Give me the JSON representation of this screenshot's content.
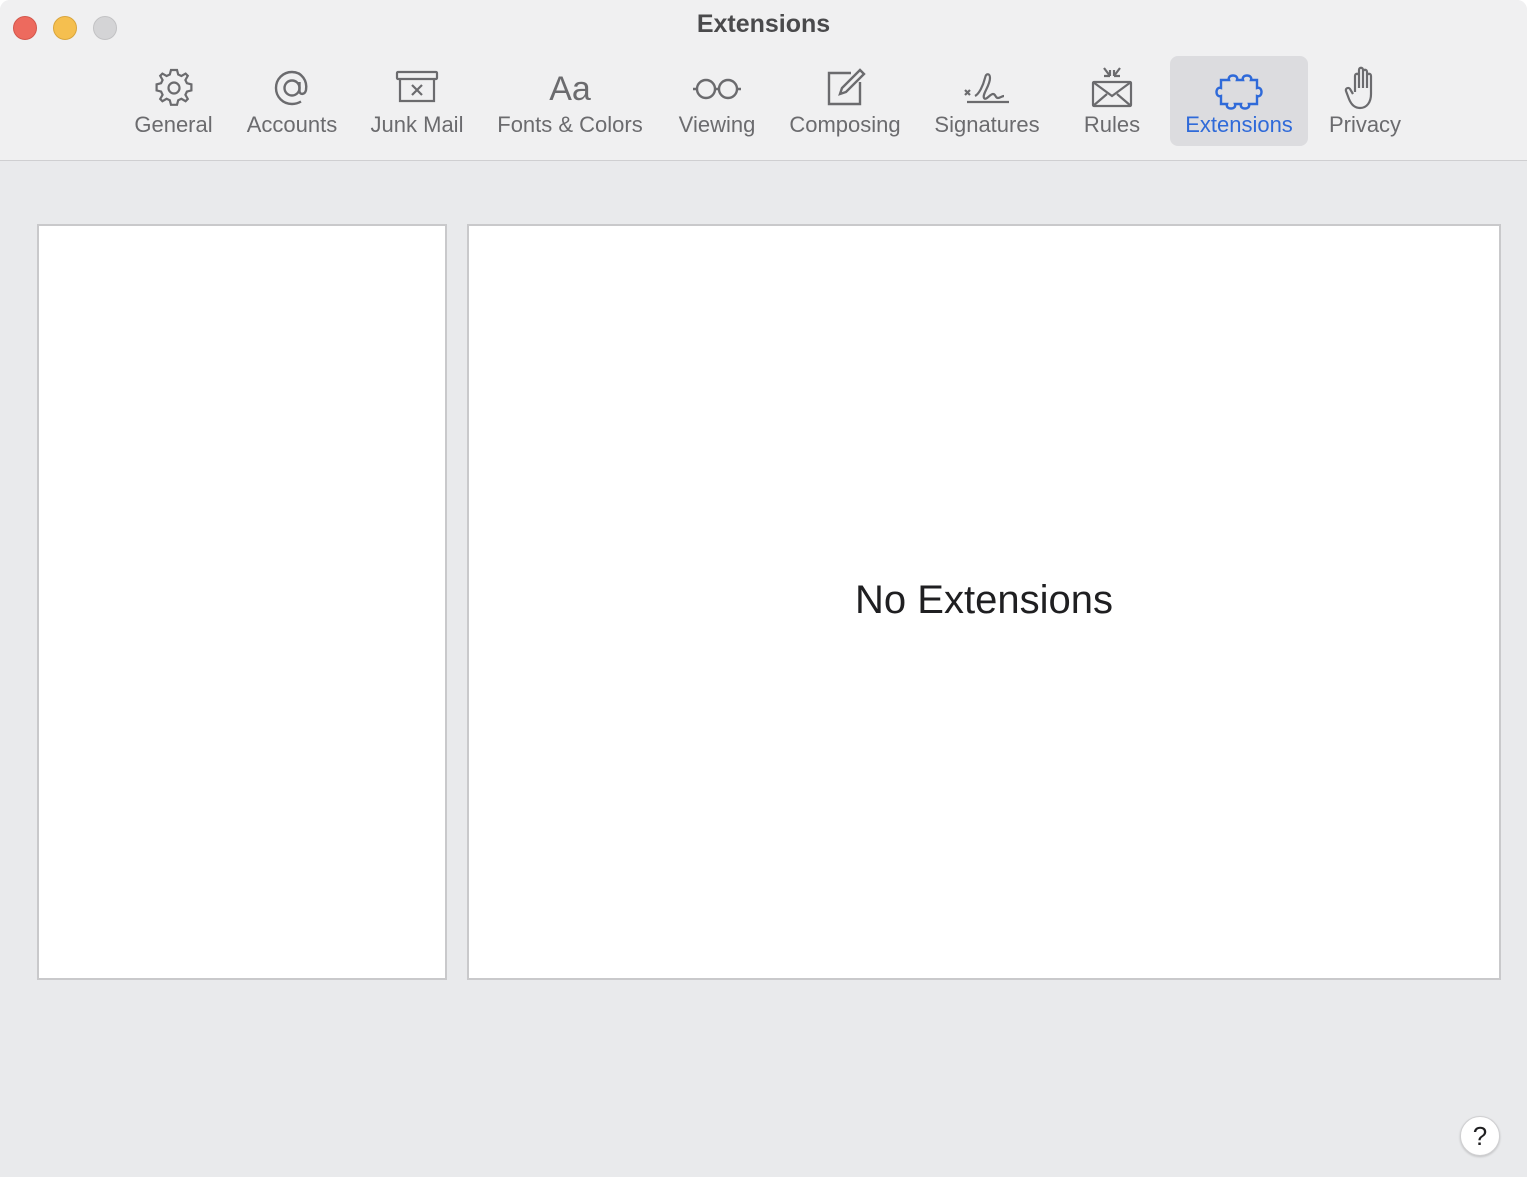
{
  "window": {
    "title": "Extensions"
  },
  "toolbar": {
    "items": [
      {
        "label": "General",
        "icon": "gear-icon"
      },
      {
        "label": "Accounts",
        "icon": "at-sign-icon"
      },
      {
        "label": "Junk Mail",
        "icon": "junk-tray-icon"
      },
      {
        "label": "Fonts & Colors",
        "icon": "text-aa-icon"
      },
      {
        "label": "Viewing",
        "icon": "glasses-icon"
      },
      {
        "label": "Composing",
        "icon": "compose-icon"
      },
      {
        "label": "Signatures",
        "icon": "signature-icon"
      },
      {
        "label": "Rules",
        "icon": "envelope-rules-icon"
      },
      {
        "label": "Extensions",
        "icon": "puzzle-piece-icon",
        "selected": true
      },
      {
        "label": "Privacy",
        "icon": "hand-icon"
      }
    ]
  },
  "main": {
    "empty_message": "No Extensions"
  },
  "help": {
    "label": "?"
  },
  "colors": {
    "accent": "#2f6ad9",
    "close": "#ed6a5e",
    "minimize": "#f5bf4f",
    "zoom": "#d4d4d6"
  }
}
